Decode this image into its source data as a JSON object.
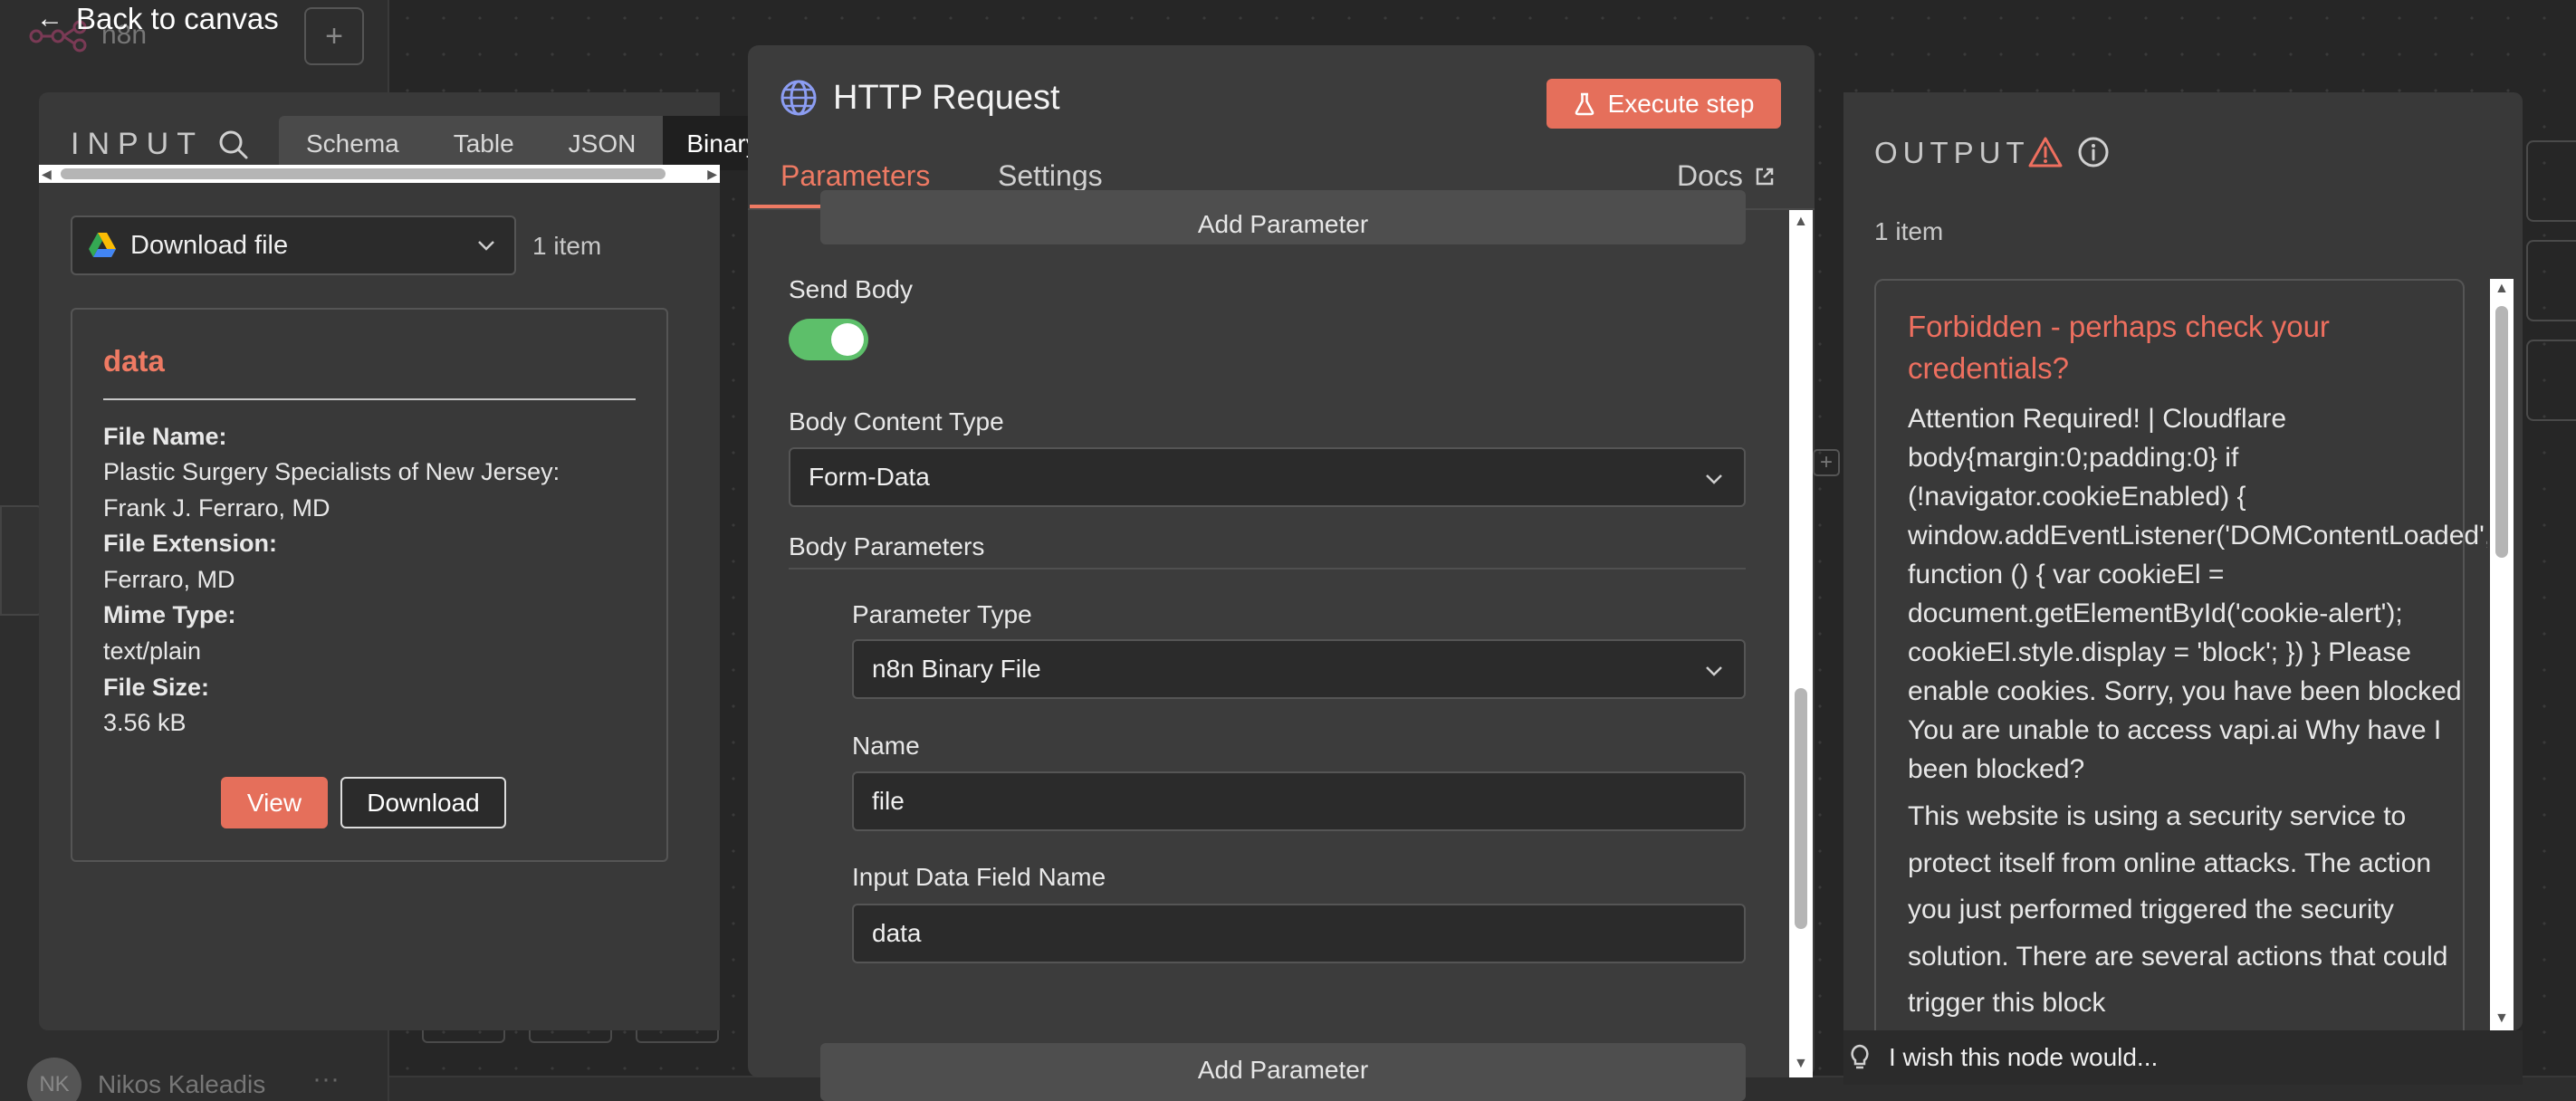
{
  "app": {
    "back_label": "Back to canvas",
    "logo_text": "n8n",
    "user_initials": "NK",
    "user_name": "Nikos Kaleadis",
    "more_icon": "ellipsis-icon"
  },
  "input_panel": {
    "title": "INPUT",
    "tabs": [
      "Schema",
      "Table",
      "JSON",
      "Binary"
    ],
    "active_tab": "Binary",
    "node_select": "Download file",
    "item_count": "1 item",
    "binary": {
      "title": "data",
      "file_name_label": "File Name:",
      "file_name_value": "Plastic Surgery Specialists of New Jersey: Frank J. Ferraro, MD",
      "file_extension_label": "File Extension:",
      "file_extension_value": "Ferraro, MD",
      "mime_type_label": "Mime Type:",
      "mime_type_value": "text/plain",
      "file_size_label": "File Size:",
      "file_size_value": "3.56 kB",
      "view_label": "View",
      "download_label": "Download"
    }
  },
  "http_panel": {
    "title": "HTTP Request",
    "execute_label": "Execute step",
    "tabs": {
      "parameters": "Parameters",
      "settings": "Settings",
      "docs": "Docs"
    },
    "add_parameter_label": "Add Parameter",
    "send_body_label": "Send Body",
    "send_body_on": true,
    "body_content_type_label": "Body Content Type",
    "body_content_type_value": "Form-Data",
    "body_parameters_label": "Body Parameters",
    "parameter_type_label": "Parameter Type",
    "parameter_type_value": "n8n Binary File",
    "name_label": "Name",
    "name_value": "file",
    "input_field_label": "Input Data Field Name",
    "input_field_value": "data"
  },
  "output_panel": {
    "title": "OUTPUT",
    "item_count": "1 item",
    "error_title": "Forbidden - perhaps check your credentials?",
    "error_body": "Attention Required! | Cloudflare body{margin:0;padding:0} if (!navigator.cookieEnabled) { window.addEventListener('DOMContentLoaded', function () { var cookieEl = document.getElementById('cookie-alert'); cookieEl.style.display = 'block'; }) } Please enable cookies. Sorry, you have been blocked You are unable to access vapi.ai Why have I been blocked?",
    "error_body_2": "This website is using a security service to protect itself from online attacks. The action you just performed triggered the security solution. There are several actions that could trigger this block",
    "feedback_label": "I wish this node would..."
  },
  "colors": {
    "accent": "#e56f5b",
    "toggle_on": "#5dbf6a",
    "error_text": "#ee6f5f"
  }
}
